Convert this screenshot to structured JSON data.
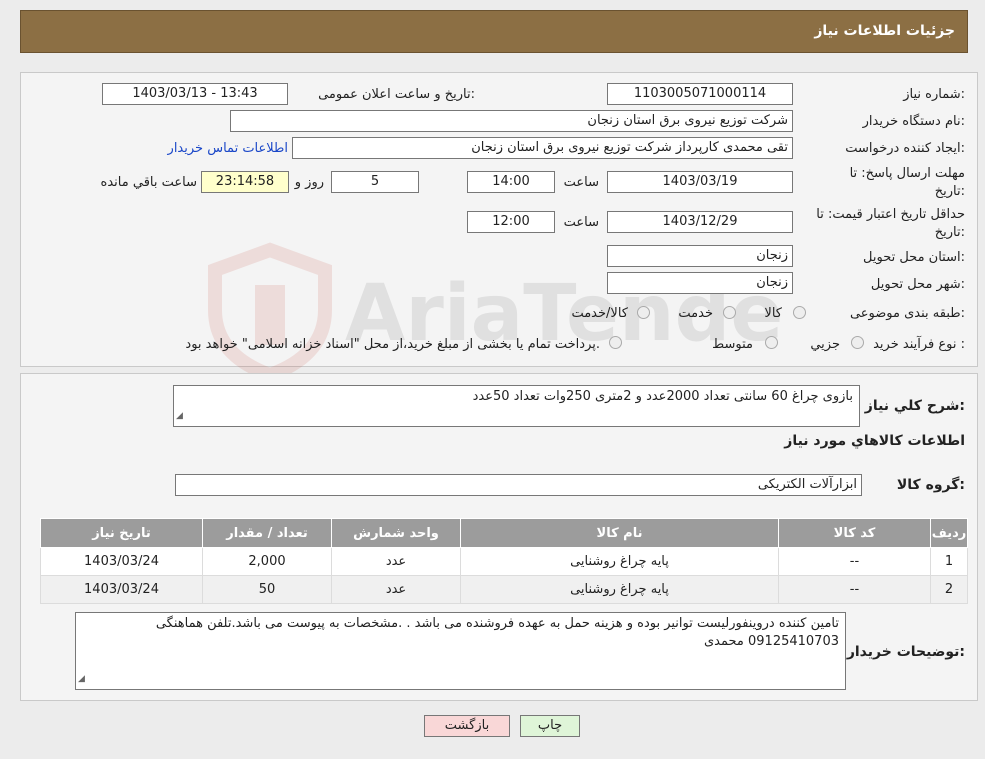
{
  "header": {
    "title": "جزئیات اطلاعات نیاز"
  },
  "form": {
    "need_number_label": "شماره نیاز:",
    "need_number": "1103005071000114",
    "announce_label": "تاریخ و ساعت اعلان عمومی:",
    "announce_value": "1403/03/13 - 13:43",
    "buyer_label": "نام دستگاه خریدار:",
    "buyer_value": "شرکت توزیع نیروی برق استان زنجان",
    "creator_label": "ایجاد کننده درخواست:",
    "creator_value": "تقی محمدی کارپرداز شرکت توزیع نیروی برق استان زنجان",
    "contact_link": "اطلاعات تماس خریدار",
    "deadline_label_1": "مهلت ارسال پاسخ: تا",
    "deadline_label_2": "تاریخ:",
    "deadline_date": "1403/03/19",
    "time_label": "ساعت",
    "deadline_time": "14:00",
    "days_value": "5",
    "days_label": "روز و",
    "remaining_time": "23:14:58",
    "remaining_label": "ساعت باقي مانده",
    "validity_label_1": "حداقل تاریخ اعتبار قیمت: تا",
    "validity_label_2": "تاریخ:",
    "validity_date": "1403/12/29",
    "validity_time": "12:00",
    "province_label": "استان محل تحویل:",
    "province_value": "زنجان",
    "city_label": "شهر محل تحویل:",
    "city_value": "زنجان",
    "category_label": "طبقه بندی موضوعی:",
    "category_options": [
      "کالا",
      "خدمت",
      "کالا/خدمت"
    ],
    "process_label": "نوع فرآیند خرید :",
    "process_options": [
      "جزيي",
      "متوسط"
    ],
    "process_note": "پرداخت تمام یا بخشی از مبلغ خرید،از محل \"اسناد خزانه اسلامی\" خواهد بود."
  },
  "details": {
    "summary_label": "شرح كلي نياز:",
    "summary_value": "بازوی چراغ 60 سانتی تعداد 2000عدد و 2متری 250وات تعداد 50عدد",
    "goods_info_title": "اطلاعات كالاهاي مورد نياز",
    "group_label": "گروه كالا:",
    "group_value": "ابزارآلات الکتریکی",
    "table": {
      "headers": [
        "رديف",
        "كد كالا",
        "نام كالا",
        "واحد شمارش",
        "تعداد / مقدار",
        "تاريخ نياز"
      ],
      "rows": [
        [
          "1",
          "--",
          "پایه چراغ روشنایی",
          "عدد",
          "2,000",
          "1403/03/24"
        ],
        [
          "2",
          "--",
          "پایه چراغ روشنایی",
          "عدد",
          "50",
          "1403/03/24"
        ]
      ]
    },
    "buyer_notes_label": "توضیحات خریدار:",
    "buyer_notes_value": "تامین کننده دروینفورلیست توانیر بوده و هزینه حمل به عهده فروشنده می باشد .  .مشخصات به پیوست می باشد.تلفن هماهنگی 09125410703 محمدی"
  },
  "buttons": {
    "print": "چاپ",
    "back": "بازگشت"
  },
  "watermark": {
    "text": "AriaTender.neT"
  },
  "colors": {
    "header": "#8c6f44",
    "yellow": "#ffffcc",
    "link": "#1a47c8",
    "back_button": "#f9d7d7",
    "print_button": "#dff5d8"
  }
}
